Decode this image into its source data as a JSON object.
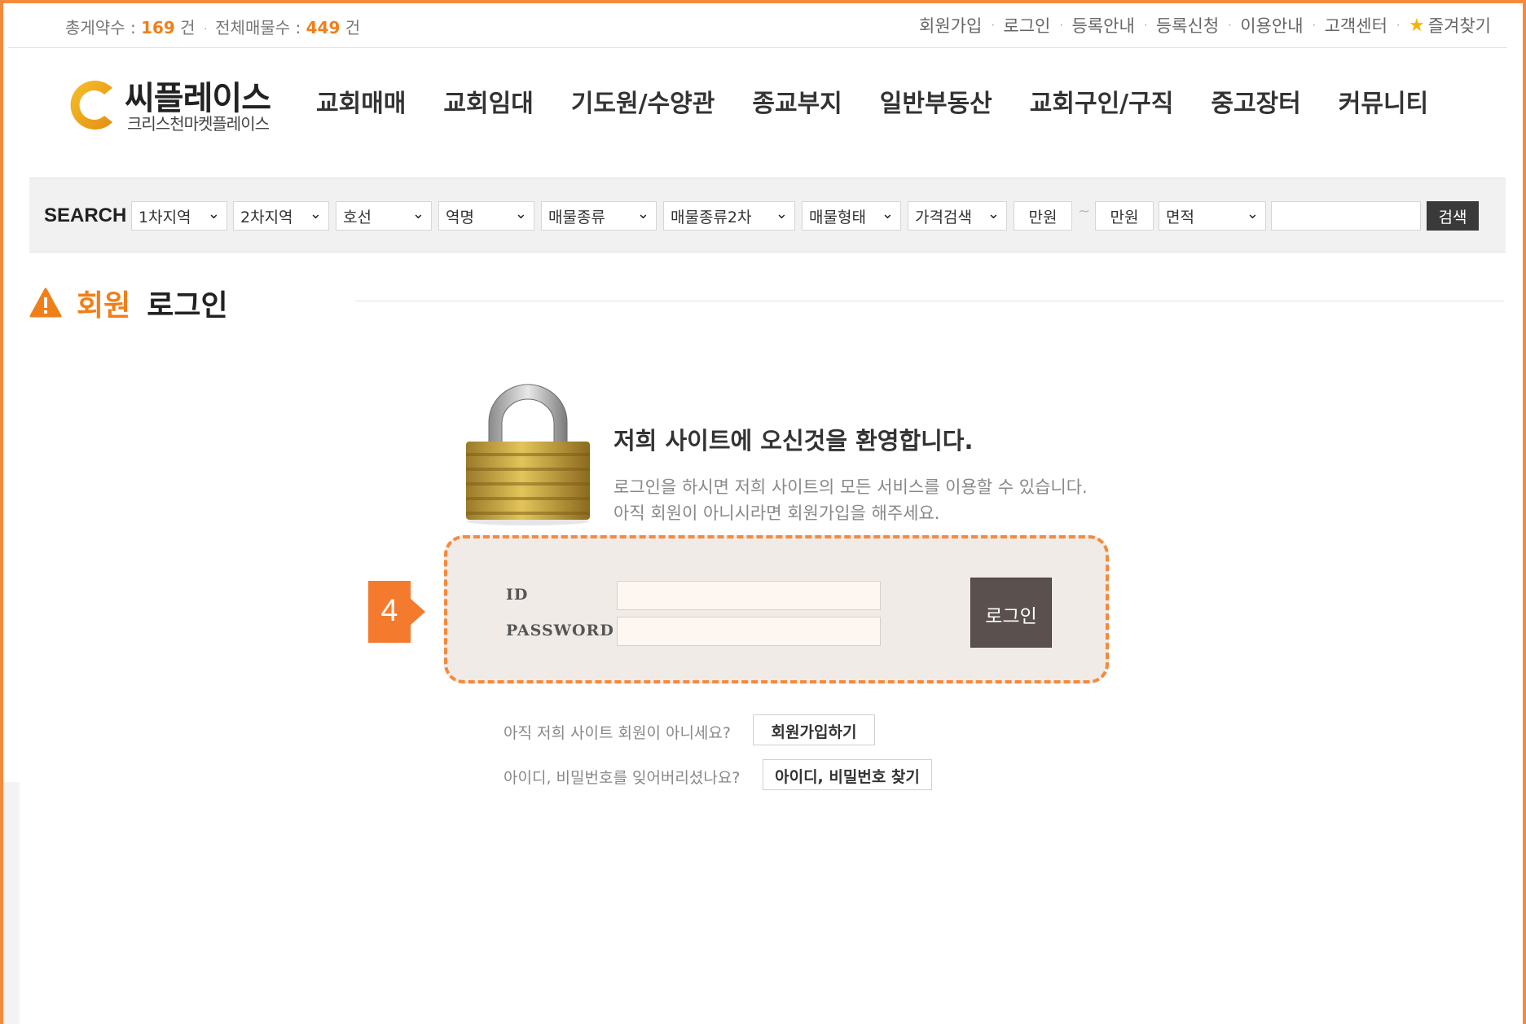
{
  "topbar": {
    "stats_label1": "총게약수 :",
    "stats_count1": "169",
    "stats_unit1": "건",
    "stats_label2": "전체매물수 :",
    "stats_count2": "449",
    "stats_unit2": "건",
    "links": [
      "회원가입",
      "로그인",
      "등록안내",
      "등록신청",
      "이용안내",
      "고객센터"
    ],
    "favorites": "즐겨찾기"
  },
  "logo": {
    "title": "씨플레이스",
    "subtitle": "크리스천마켓플레이스",
    "brand_color": "#f2a81d"
  },
  "gnb": [
    "교회매매",
    "교회임대",
    "기도원/수양관",
    "종교부지",
    "일반부동산",
    "교회구인/구직",
    "중고장터",
    "커뮤니티"
  ],
  "search": {
    "label": "SEARCH",
    "selects": [
      "1차지역",
      "2차지역",
      "호선",
      "역명",
      "매물종류",
      "매물종류2차",
      "매물형태",
      "가격검색"
    ],
    "price_min_unit": "만원",
    "price_sep": "~",
    "price_max_unit": "만원",
    "area_select": "면적",
    "keyword_value": "",
    "button": "검색"
  },
  "page_title": {
    "part1": "회원",
    "part2": "로그인",
    "accent": "#f07f1a"
  },
  "welcome": {
    "heading": "저희 사이트에 오신것을 환영합니다.",
    "line1": "로그인을 하시면 저희 사이트의 모든 서비스를 이용할 수 있습니다.",
    "line2": "아직 회원이 아니시라면 회원가입을 해주세요."
  },
  "login": {
    "id_label": "ID",
    "password_label": "PASSWORD",
    "id_value": "",
    "password_value": "",
    "submit": "로그인",
    "step_marker": "4"
  },
  "help": {
    "signup_question": "아직 저희 사이트 회원이 아니세요?",
    "signup_button": "회원가입하기",
    "find_question": "아이디, 비밀번호를 잊어버리셨나요?",
    "find_button": "아이디, 비밀번호 찾기"
  }
}
